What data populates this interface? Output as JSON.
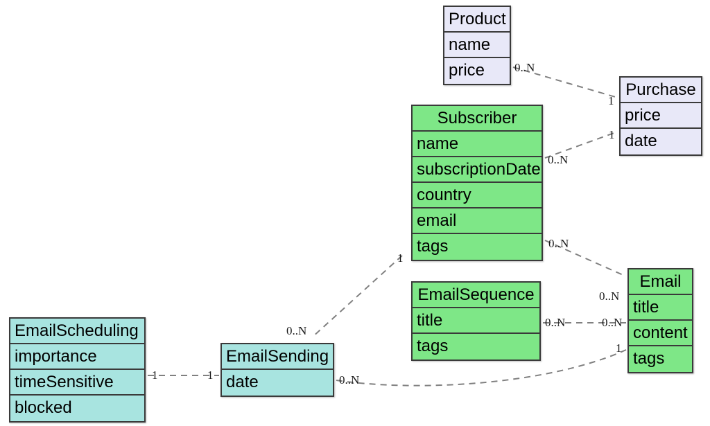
{
  "diagram": {
    "kind": "uml-class-diagram",
    "background": "#ffffff",
    "palette": {
      "lavender": "#e8e8f8",
      "green": "#7ee787",
      "cyan": "#a8e4e0",
      "border": "#3a3a3a",
      "edge": "#808080"
    }
  },
  "entities": [
    {
      "id": "product",
      "name": "Product",
      "color": "lavender",
      "attributes": [
        "name",
        "price"
      ]
    },
    {
      "id": "purchase",
      "name": "Purchase",
      "color": "lavender",
      "attributes": [
        "price",
        "date"
      ]
    },
    {
      "id": "subscriber",
      "name": "Subscriber",
      "color": "green",
      "attributes": [
        "name",
        "subscriptionDate",
        "country",
        "email",
        "tags"
      ]
    },
    {
      "id": "emailsequence",
      "name": "EmailSequence",
      "color": "green",
      "attributes": [
        "title",
        "tags"
      ]
    },
    {
      "id": "email",
      "name": "Email",
      "color": "green",
      "attributes": [
        "title",
        "content",
        "tags"
      ]
    },
    {
      "id": "emailscheduling",
      "name": "EmailScheduling",
      "color": "cyan",
      "attributes": [
        "importance",
        "timeSensitive",
        "blocked"
      ]
    },
    {
      "id": "emailsending",
      "name": "EmailSending",
      "color": "cyan",
      "attributes": [
        "date"
      ]
    }
  ],
  "relationships": [
    {
      "id": "product-purchase",
      "from": "product",
      "to": "purchase",
      "from_multiplicity": "0..N",
      "to_multiplicity": "1",
      "style": "dashed"
    },
    {
      "id": "subscriber-purchase",
      "from": "subscriber",
      "to": "purchase",
      "from_multiplicity": "0..N",
      "to_multiplicity": "1",
      "style": "dashed"
    },
    {
      "id": "subscriber-email",
      "from": "subscriber",
      "to": "email",
      "from_multiplicity": "0..N",
      "to_multiplicity": "0..N",
      "style": "dashed"
    },
    {
      "id": "subscriber-emailsending",
      "from": "subscriber",
      "to": "emailsending",
      "from_multiplicity": "1",
      "to_multiplicity": "0..N",
      "style": "dashed"
    },
    {
      "id": "emailsequence-email",
      "from": "emailsequence",
      "to": "email",
      "from_multiplicity": "0..N",
      "to_multiplicity": "0..N",
      "style": "dashed"
    },
    {
      "id": "emailsending-email",
      "from": "emailsending",
      "to": "email",
      "from_multiplicity": "0..N",
      "to_multiplicity": "1",
      "style": "dashed"
    },
    {
      "id": "emailscheduling-emailsending",
      "from": "emailscheduling",
      "to": "emailsending",
      "from_multiplicity": "1",
      "to_multiplicity": "1",
      "style": "dashed"
    }
  ],
  "multiplicity_labels": [
    {
      "id": "m-product-out",
      "text": "0..N"
    },
    {
      "id": "m-purchase-in-top",
      "text": "1"
    },
    {
      "id": "m-purchase-in-bottom",
      "text": "1"
    },
    {
      "id": "m-subscriber-purchase",
      "text": "0..N"
    },
    {
      "id": "m-subscriber-email",
      "text": "0..N"
    },
    {
      "id": "m-subscriber-sending",
      "text": "1"
    },
    {
      "id": "m-sending-subscriber",
      "text": "0..N"
    },
    {
      "id": "m-sequence-out",
      "text": "0..N"
    },
    {
      "id": "m-email-in-mid",
      "text": "0..N"
    },
    {
      "id": "m-email-in-top",
      "text": "0..N"
    },
    {
      "id": "m-email-in-bottom",
      "text": "1"
    },
    {
      "id": "m-sending-out",
      "text": "0..N"
    },
    {
      "id": "m-scheduling-out",
      "text": "1"
    },
    {
      "id": "m-sending-in",
      "text": "1"
    }
  ]
}
